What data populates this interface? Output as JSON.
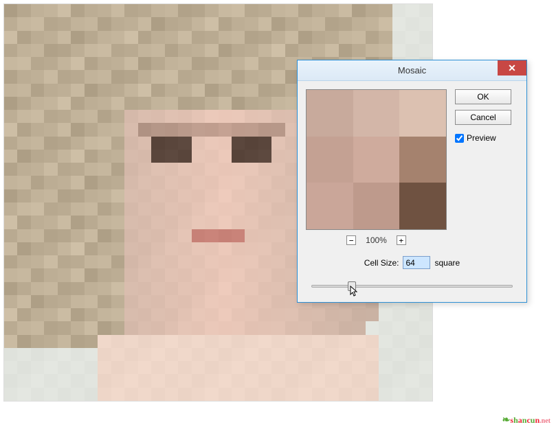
{
  "dialog": {
    "title": "Mosaic",
    "ok_label": "OK",
    "cancel_label": "Cancel",
    "preview_label": "Preview",
    "preview_checked": true,
    "zoom_label": "100%",
    "cell_size_label": "Cell Size:",
    "cell_size_value": "64",
    "cell_size_unit": "square",
    "slider_position_pct": 20
  },
  "preview_colors": [
    "#c8aa9c",
    "#d3b6a8",
    "#dcc1b1",
    "#c4a193",
    "#cfab9d",
    "#a5826e",
    "#caa699",
    "#be9a8c",
    "#6f5241"
  ],
  "watermark": {
    "text": "shancun",
    "suffix": ".net"
  }
}
